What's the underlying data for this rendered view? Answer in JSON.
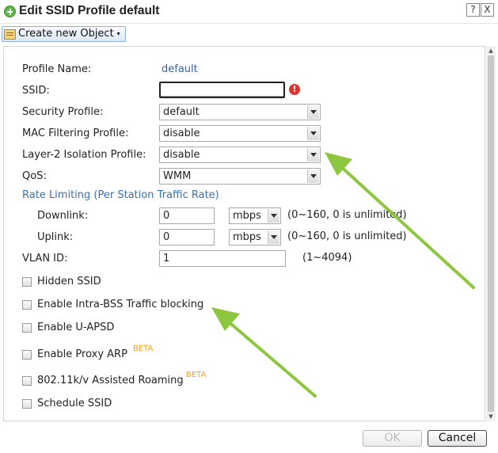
{
  "window": {
    "title": "Edit SSID Profile default",
    "help_glyph": "?",
    "close_glyph": "X"
  },
  "toolbar": {
    "create_label": "Create new Object",
    "caret": "▾"
  },
  "form": {
    "profile_name_label": "Profile Name:",
    "profile_name_value": "default",
    "ssid_label": "SSID:",
    "ssid_value": "",
    "ssid_error_glyph": "!",
    "security_label": "Security Profile:",
    "security_value": "default",
    "mac_label": "MAC Filtering Profile:",
    "mac_value": "disable",
    "l2_label": "Layer-2 Isolation Profile:",
    "l2_value": "disable",
    "qos_label": "QoS:",
    "qos_value": "WMM",
    "rate_section": "Rate Limiting (Per Station Traffic Rate)",
    "downlink_label": "Downlink:",
    "downlink_value": "0",
    "downlink_unit": "mbps",
    "downlink_hint": "(0~160, 0 is unlimited)",
    "uplink_label": "Uplink:",
    "uplink_value": "0",
    "uplink_unit": "mbps",
    "uplink_hint": "(0~160, 0 is unlimited)",
    "vlan_label": "VLAN ID:",
    "vlan_value": "1",
    "vlan_hint": "(1~4094)"
  },
  "checkboxes": [
    {
      "label": "Hidden SSID",
      "checked": false
    },
    {
      "label": "Enable Intra-BSS Traffic blocking",
      "checked": false
    },
    {
      "label": "Enable U-APSD",
      "checked": false
    },
    {
      "label": "Enable Proxy ARP",
      "checked": false,
      "badge": "BETA"
    },
    {
      "label": "802.11k/v Assisted Roaming",
      "checked": false,
      "badge": "BETA"
    },
    {
      "label": "Schedule SSID",
      "checked": false
    }
  ],
  "footer": {
    "ok_label": "OK",
    "cancel_label": "Cancel"
  },
  "colors": {
    "annotation_arrow": "#8dc63f",
    "link_blue": "#3b6fb0",
    "beta_orange": "#f0a020",
    "error_red": "#e0332d"
  }
}
